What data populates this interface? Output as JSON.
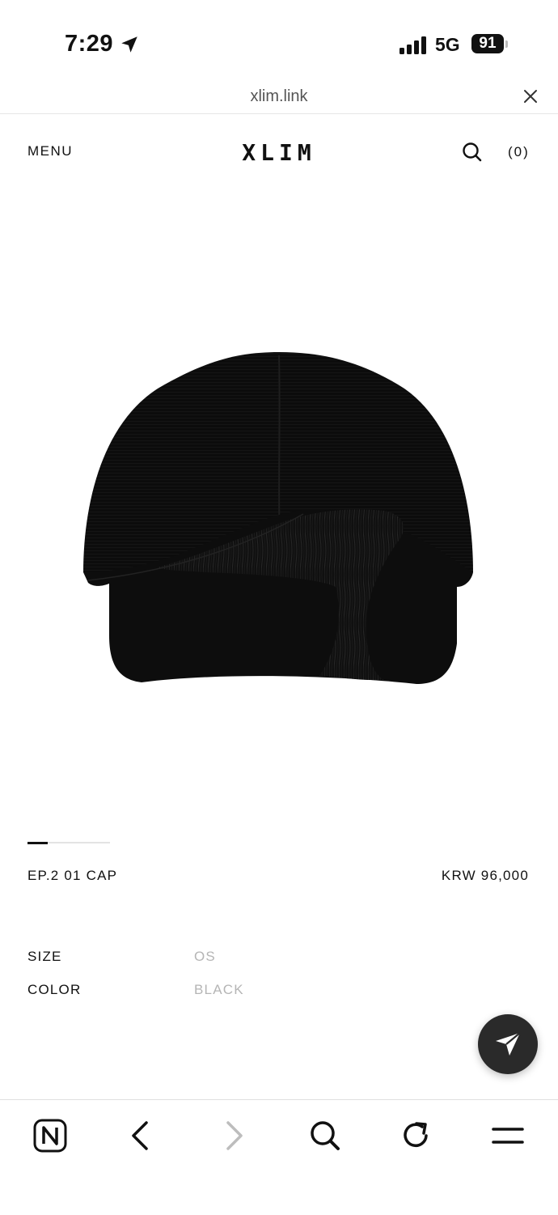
{
  "status_bar": {
    "time": "7:29",
    "network": "5G",
    "battery": "91",
    "icons": [
      "location-arrow-icon",
      "signal-bars-icon",
      "battery-icon"
    ]
  },
  "browser": {
    "url": "xlim.link",
    "close_icon": "close-icon"
  },
  "header": {
    "menu_label": "MENU",
    "logo": "XLIM",
    "search_icon": "search-icon",
    "cart_label": "(0)"
  },
  "product": {
    "image_alt": "black-cap-image",
    "carousel": {
      "current": 1,
      "total": 4
    },
    "name": "EP.2 01 CAP",
    "price": "KRW 96,000",
    "options": [
      {
        "label": "SIZE",
        "value": "OS"
      },
      {
        "label": "COLOR",
        "value": "BLACK"
      }
    ]
  },
  "floating_button": {
    "icon": "send-icon"
  },
  "toolbar": {
    "items": [
      "naver-home-icon",
      "back-icon",
      "forward-icon",
      "search-icon",
      "refresh-icon",
      "menu-icon"
    ]
  },
  "colors": {
    "text": "#111111",
    "muted": "#b5b5b5",
    "divider": "#e3e3e3",
    "fab": "#2a2a2a"
  }
}
